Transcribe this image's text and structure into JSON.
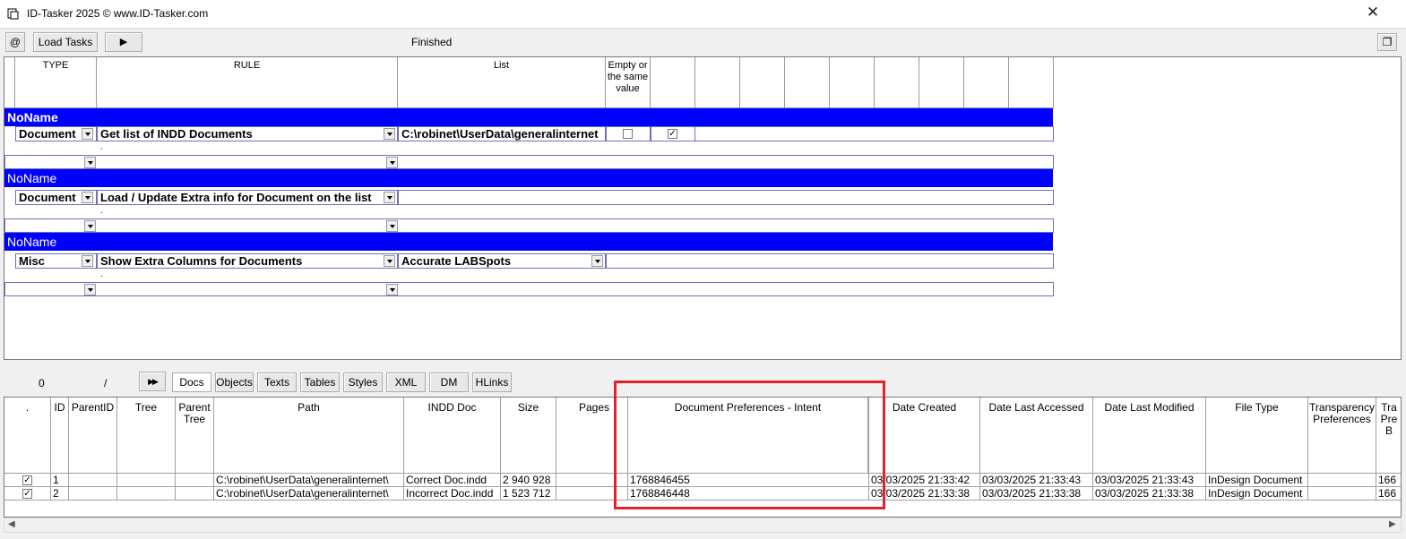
{
  "window": {
    "title": "ID-Tasker 2025  © www.ID-Tasker.com",
    "close_label": "✕"
  },
  "toolbar": {
    "at_label": "@",
    "load_tasks_label": "Load Tasks",
    "run_label": "▶",
    "status": "Finished",
    "restore_label": "❐"
  },
  "task_grid": {
    "headers": {
      "type": "TYPE",
      "rule": "RULE",
      "list": "List",
      "empty": "Empty or the same value"
    },
    "groups": [
      {
        "name": "NoName",
        "type": "Document",
        "rule": "Get list of INDD Documents",
        "list": "C:\\robinet\\UserData\\generalinternet",
        "empty_checked": false,
        "col5_checked": true
      },
      {
        "name": "NoName",
        "type": "Document",
        "rule": "Load / Update Extra info for Document on the list",
        "list": ""
      },
      {
        "name": "NoName",
        "type": "Misc",
        "rule": "Show Extra Columns for Documents",
        "list": "Accurate LABSpots"
      }
    ],
    "dot": "."
  },
  "bottom_toolbar": {
    "count": "0",
    "separator": "/",
    "ff_label": "▶▶",
    "tabs": [
      "Docs",
      "Objects",
      "Texts",
      "Tables",
      "Styles",
      "XML",
      "DM",
      "HLinks"
    ]
  },
  "doc_grid": {
    "headers": [
      ".",
      "ID",
      "ParentID",
      "Tree",
      "Parent Tree",
      "Path",
      "INDD Doc",
      "Size",
      "Pages",
      "Document Preferences - Intent",
      "",
      "Date Created",
      "Date Last Accessed",
      "Date Last Modified",
      "File Type",
      "Transparency Preferences",
      "Tra Pre B"
    ],
    "rows": [
      {
        "checked": true,
        "id": "1",
        "path": "C:\\robinet\\UserData\\generalinternet\\",
        "indd": "Correct Doc.indd",
        "size": "2 940 928",
        "intent": "1768846455",
        "created": "03/03/2025 21:33:42",
        "accessed": "03/03/2025 21:33:43",
        "modified": "03/03/2025 21:33:43",
        "filetype": "InDesign Document",
        "last": "166"
      },
      {
        "checked": true,
        "id": "2",
        "path": "C:\\robinet\\UserData\\generalinternet\\",
        "indd": "Incorrect Doc.indd",
        "size": "1 523 712",
        "intent": "1768846448",
        "created": "03/03/2025 21:33:38",
        "accessed": "03/03/2025 21:33:38",
        "modified": "03/03/2025 21:33:38",
        "filetype": "InDesign Document",
        "last": "166"
      }
    ]
  },
  "colors": {
    "group_bar": "#0000ff",
    "highlight": "#e0232d"
  }
}
